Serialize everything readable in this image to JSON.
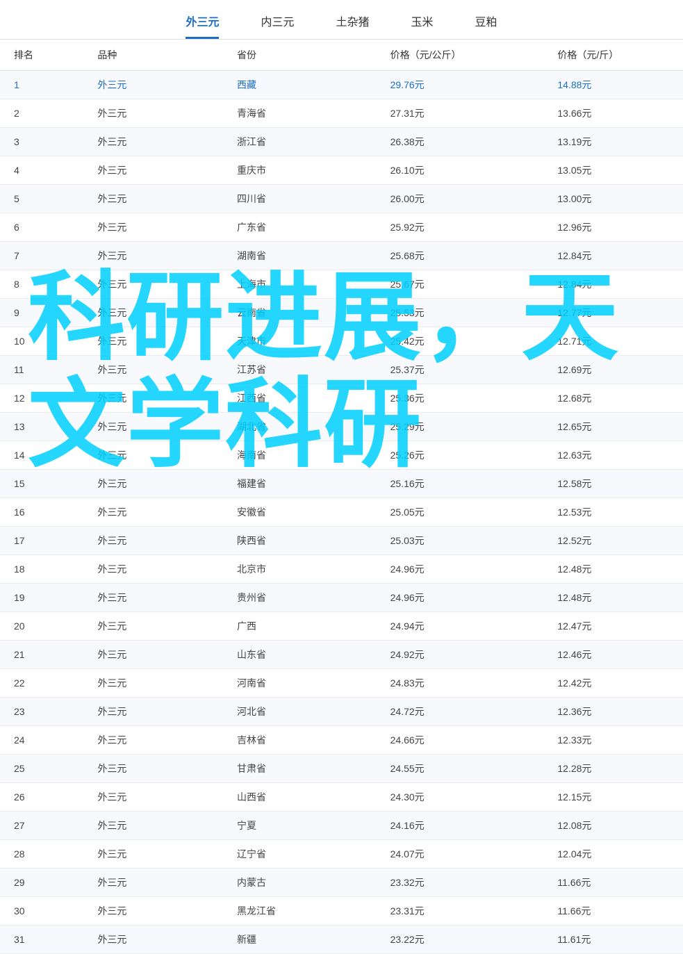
{
  "tabs": [
    {
      "id": "waisan",
      "label": "外三元",
      "active": true
    },
    {
      "id": "neisan",
      "label": "内三元",
      "active": false
    },
    {
      "id": "tuzhu",
      "label": "土杂猪",
      "active": false
    },
    {
      "id": "yumi",
      "label": "玉米",
      "active": false
    },
    {
      "id": "doupo",
      "label": "豆粕",
      "active": false
    }
  ],
  "table": {
    "headers": [
      "排名",
      "品种",
      "省份",
      "价格（元/公斤）",
      "价格（元/斤）"
    ],
    "rows": [
      [
        "1",
        "外三元",
        "西藏",
        "29.76元",
        "14.88元"
      ],
      [
        "2",
        "外三元",
        "青海省",
        "27.31元",
        "13.66元"
      ],
      [
        "3",
        "外三元",
        "浙江省",
        "26.38元",
        "13.19元"
      ],
      [
        "4",
        "外三元",
        "重庆市",
        "26.10元",
        "13.05元"
      ],
      [
        "5",
        "外三元",
        "四川省",
        "26.00元",
        "13.00元"
      ],
      [
        "6",
        "外三元",
        "广东省",
        "25.92元",
        "12.96元"
      ],
      [
        "7",
        "外三元",
        "湖南省",
        "25.68元",
        "12.84元"
      ],
      [
        "8",
        "外三元",
        "上海市",
        "25.67元",
        "12.84元"
      ],
      [
        "9",
        "外三元",
        "云南省",
        "25.53元",
        "12.77元"
      ],
      [
        "10",
        "外三元",
        "天津市",
        "25.42元",
        "12.71元"
      ],
      [
        "11",
        "外三元",
        "江苏省",
        "25.37元",
        "12.69元"
      ],
      [
        "12",
        "外三元",
        "江西省",
        "25.36元",
        "12.68元"
      ],
      [
        "13",
        "外三元",
        "湖北省",
        "25.29元",
        "12.65元"
      ],
      [
        "14",
        "外三元",
        "海南省",
        "25.26元",
        "12.63元"
      ],
      [
        "15",
        "外三元",
        "福建省",
        "25.16元",
        "12.58元"
      ],
      [
        "16",
        "外三元",
        "安徽省",
        "25.05元",
        "12.53元"
      ],
      [
        "17",
        "外三元",
        "陕西省",
        "25.03元",
        "12.52元"
      ],
      [
        "18",
        "外三元",
        "北京市",
        "24.96元",
        "12.48元"
      ],
      [
        "19",
        "外三元",
        "贵州省",
        "24.96元",
        "12.48元"
      ],
      [
        "20",
        "外三元",
        "广西",
        "24.94元",
        "12.47元"
      ],
      [
        "21",
        "外三元",
        "山东省",
        "24.92元",
        "12.46元"
      ],
      [
        "22",
        "外三元",
        "河南省",
        "24.83元",
        "12.42元"
      ],
      [
        "23",
        "外三元",
        "河北省",
        "24.72元",
        "12.36元"
      ],
      [
        "24",
        "外三元",
        "吉林省",
        "24.66元",
        "12.33元"
      ],
      [
        "25",
        "外三元",
        "甘肃省",
        "24.55元",
        "12.28元"
      ],
      [
        "26",
        "外三元",
        "山西省",
        "24.30元",
        "12.15元"
      ],
      [
        "27",
        "外三元",
        "宁夏",
        "24.16元",
        "12.08元"
      ],
      [
        "28",
        "外三元",
        "辽宁省",
        "24.07元",
        "12.04元"
      ],
      [
        "29",
        "外三元",
        "内蒙古",
        "23.32元",
        "11.66元"
      ],
      [
        "30",
        "外三元",
        "黑龙江省",
        "23.31元",
        "11.66元"
      ],
      [
        "31",
        "外三元",
        "新疆",
        "23.22元",
        "11.61元"
      ]
    ]
  },
  "watermark": {
    "line1": "科研进展，天",
    "line2": "文学科研"
  }
}
